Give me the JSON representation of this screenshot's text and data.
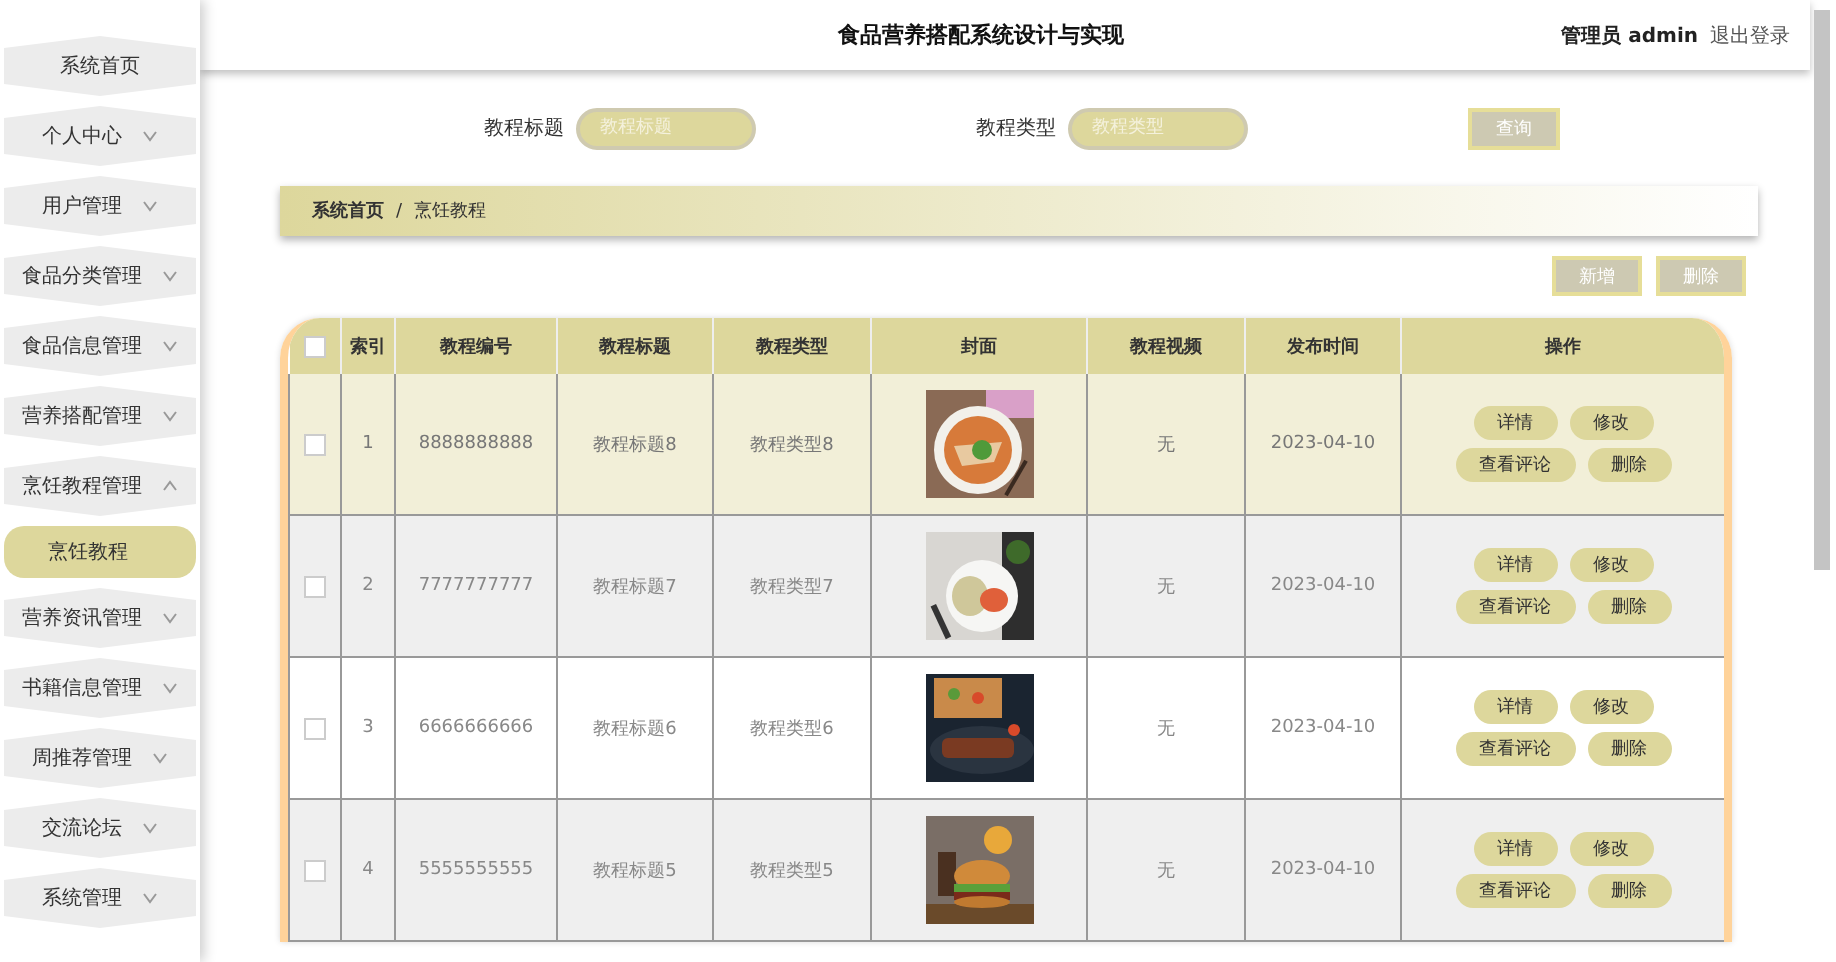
{
  "header": {
    "title": "食品营养搭配系统设计与实现",
    "user_role": "管理员",
    "user_name": "admin",
    "logout": "退出登录"
  },
  "sidebar": {
    "items": [
      {
        "label": "系统首页",
        "has_caret": false
      },
      {
        "label": "个人中心",
        "has_caret": true,
        "expanded": false
      },
      {
        "label": "用户管理",
        "has_caret": true,
        "expanded": false
      },
      {
        "label": "食品分类管理",
        "has_caret": true,
        "expanded": false
      },
      {
        "label": "食品信息管理",
        "has_caret": true,
        "expanded": false
      },
      {
        "label": "营养搭配管理",
        "has_caret": true,
        "expanded": false
      },
      {
        "label": "烹饪教程管理",
        "has_caret": true,
        "expanded": true,
        "children": [
          {
            "label": "烹饪教程",
            "selected": true
          }
        ]
      },
      {
        "label": "营养资讯管理",
        "has_caret": true,
        "expanded": false
      },
      {
        "label": "书籍信息管理",
        "has_caret": true,
        "expanded": false
      },
      {
        "label": "周推荐管理",
        "has_caret": true,
        "expanded": false
      },
      {
        "label": "交流论坛",
        "has_caret": true,
        "expanded": false
      },
      {
        "label": "系统管理",
        "has_caret": true,
        "expanded": false
      }
    ]
  },
  "search": {
    "fields": [
      {
        "label": "教程标题",
        "placeholder": "教程标题"
      },
      {
        "label": "教程类型",
        "placeholder": "教程类型"
      }
    ],
    "button": "查询"
  },
  "breadcrumb": {
    "home": "系统首页",
    "separator": "/",
    "current": "烹饪教程"
  },
  "toolbar": {
    "buttons": [
      "新增",
      "删除"
    ]
  },
  "table": {
    "columns": [
      "索引",
      "教程编号",
      "教程标题",
      "教程类型",
      "封面",
      "教程视频",
      "发布时间",
      "操作"
    ],
    "header_checked": false,
    "rows": [
      {
        "checked": false,
        "highlighted": true,
        "index": "1",
        "code": "8888888888",
        "title": "教程标题8",
        "type": "教程类型8",
        "video": "无",
        "date": "2023-04-10",
        "actions": [
          "详情",
          "修改",
          "查看评论",
          "删除"
        ]
      },
      {
        "checked": false,
        "highlighted": false,
        "index": "2",
        "code": "7777777777",
        "title": "教程标题7",
        "type": "教程类型7",
        "video": "无",
        "date": "2023-04-10",
        "actions": [
          "详情",
          "修改",
          "查看评论",
          "删除"
        ]
      },
      {
        "checked": false,
        "highlighted": false,
        "index": "3",
        "code": "6666666666",
        "title": "教程标题6",
        "type": "教程类型6",
        "video": "无",
        "date": "2023-04-10",
        "actions": [
          "详情",
          "修改",
          "查看评论",
          "删除"
        ]
      },
      {
        "checked": false,
        "highlighted": false,
        "index": "4",
        "code": "5555555555",
        "title": "教程标题5",
        "type": "教程类型5",
        "video": "无",
        "date": "2023-04-10",
        "actions": [
          "详情",
          "修改",
          "查看评论",
          "删除"
        ]
      }
    ]
  }
}
